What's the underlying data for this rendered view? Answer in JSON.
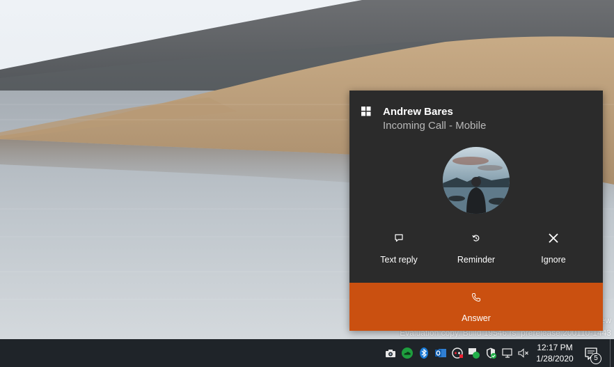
{
  "watermark": {
    "line1": "ew",
    "line2": "Evaluation copy. Build 19546.rs_prerelease.200110-1443"
  },
  "toast": {
    "app_icon": "windows-app-icon",
    "caller_name": "Andrew Bares",
    "subtitle": "Incoming Call - Mobile",
    "actions": [
      {
        "label": "Text reply",
        "icon": "chat-bubble-icon"
      },
      {
        "label": "Reminder",
        "icon": "reminder-icon"
      },
      {
        "label": "Ignore",
        "icon": "close-icon"
      }
    ],
    "answer": {
      "label": "Answer",
      "icon": "phone-icon"
    },
    "colors": {
      "background": "#2b2b2b",
      "answer": "#ca5010",
      "subtitle": "#b9b9b9"
    }
  },
  "taskbar": {
    "tray_icons": [
      "camera-icon",
      "green-cloud-icon",
      "bluetooth-icon",
      "outlook-icon",
      "gamepad-icon",
      "chat-icon",
      "security-shield-icon",
      "network-icon",
      "volume-muted-icon"
    ],
    "clock": {
      "time": "12:17 PM",
      "date": "1/28/2020"
    },
    "notifications_count": "5"
  }
}
